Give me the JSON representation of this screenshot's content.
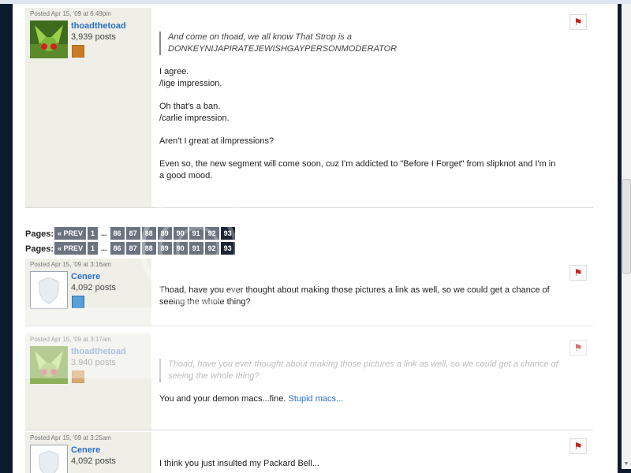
{
  "posts": [
    {
      "posted": "Posted Apr 15, '09 at 6:49pm",
      "username": "thoadthetoad",
      "post_count": "3,939 posts",
      "quote": "And come on thoad, we all know That Strop is a DONKEYNIJAPIRATEJEWISHGAYPERSONMODERATOR",
      "lines": [
        "I agree.\n/lige impression.",
        "Oh that's a ban.\n/carlie impression.",
        "Aren't I great at ilmpressions?",
        "Even so, the new segment will come soon, cuz I'm addicted to \"Before I Forget\" from slipknot and I'm in a good mood."
      ]
    },
    {
      "posted": "Posted Apr 15, '09 at 3:16am",
      "username": "Cenere",
      "post_count": "4,092 posts",
      "text": "Thoad, have you ever thought about making those pictures a link as well, so we could get a chance of seeing the whole thing?"
    },
    {
      "posted": "Posted Apr 15, '09 at 3:17am",
      "username": "thoadthetoad",
      "post_count": "3,940 posts",
      "quote": "Thoad, have you ever thought about making those pictures a link as well, so we could get a chance of seeing the whole thing?",
      "text": "You and your demon macs...fine.",
      "link": "Stupid macs..."
    },
    {
      "posted": "Posted Apr 15, '09 at 3:25am",
      "username": "Cenere",
      "post_count": "4,092 posts",
      "text": "I think you just insulted my Packard Bell..."
    }
  ],
  "pagination": {
    "label": "Pages:",
    "prev": "« PREV",
    "first": "1",
    "ellipsis": "...",
    "pages": [
      "86",
      "87",
      "88",
      "89",
      "90",
      "91",
      "92"
    ],
    "current": "93"
  },
  "colors": {
    "username": "#2b6fc6",
    "sidebar": "#efefe8",
    "pager_bg": "#6b7280",
    "pager_current": "#1d2533",
    "flag": "#c81e1e"
  },
  "icons": [
    "report-flag-icon",
    "avatar-image",
    "user-badge-icon"
  ]
}
